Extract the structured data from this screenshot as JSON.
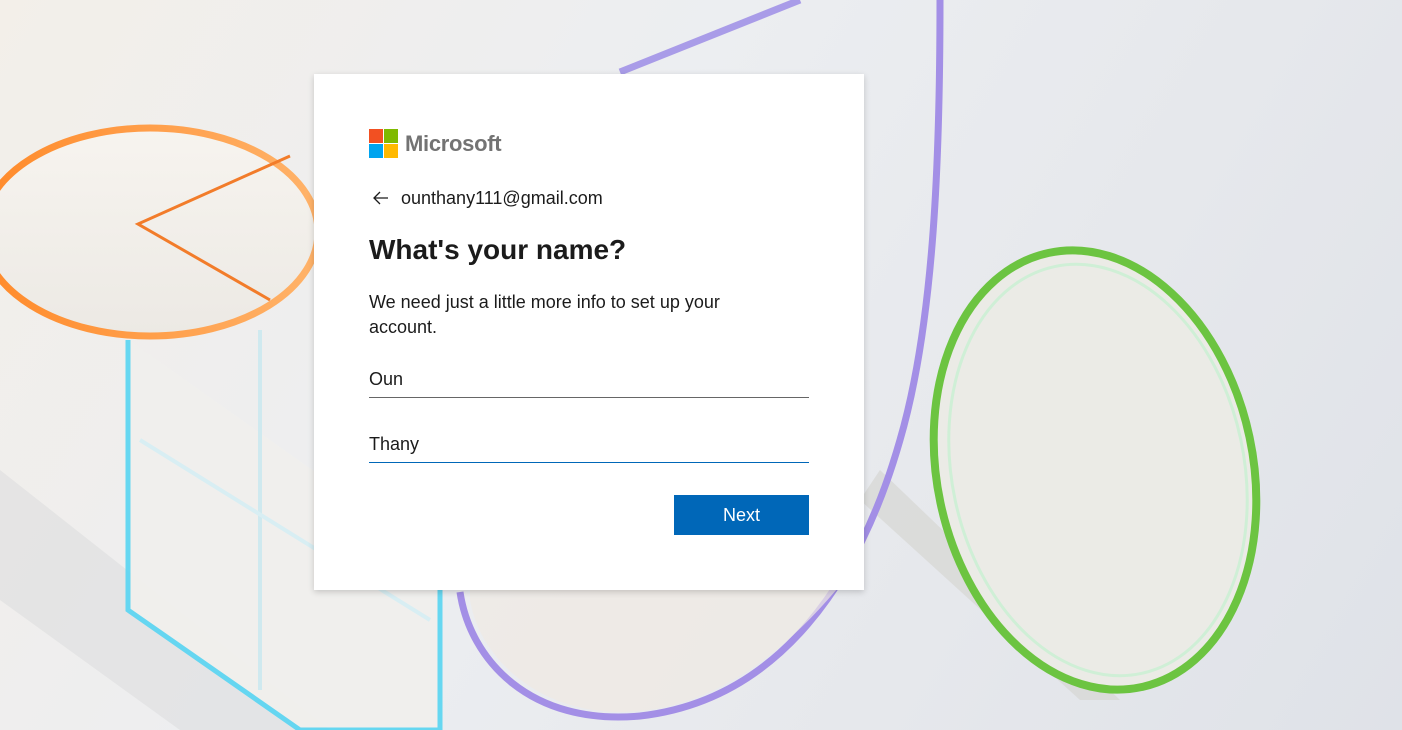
{
  "brand": {
    "name": "Microsoft",
    "logo_colors": [
      "#f25022",
      "#7fba00",
      "#00a4ef",
      "#ffb900"
    ]
  },
  "identity": {
    "email": "ounthany111@gmail.com",
    "back_icon": "arrow-left-icon"
  },
  "heading": "What's your name?",
  "description": "We need just a little more info to set up your account.",
  "form": {
    "first_name": {
      "value": "Oun"
    },
    "last_name": {
      "value": "Thany"
    }
  },
  "actions": {
    "next_label": "Next"
  },
  "colors": {
    "accent": "#0067b8",
    "text": "#1b1b1b",
    "logo_text": "#737373"
  }
}
